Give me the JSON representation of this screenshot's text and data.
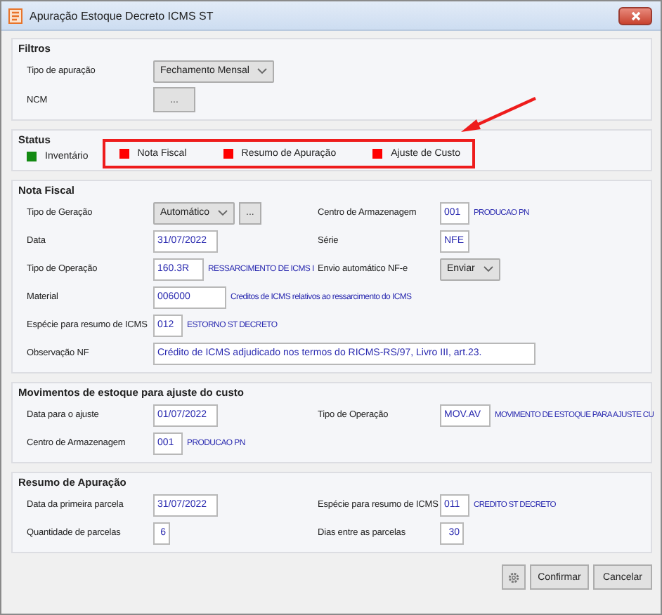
{
  "window": {
    "title": "Apuração Estoque Decreto ICMS ST"
  },
  "sections": [
    {
      "title": "Filtros",
      "kind": "form",
      "rows": [
        {
          "left": {
            "label": "Tipo de apuração",
            "control": {
              "kind": "select",
              "value": "Fechamento Mensal"
            }
          }
        },
        {
          "left": {
            "label": "NCM",
            "control": {
              "kind": "button",
              "value": "..."
            }
          }
        }
      ]
    },
    {
      "title": "Status",
      "kind": "status",
      "items": [
        {
          "label": "Inventário",
          "color": "#138a13",
          "highlighted": false
        },
        {
          "label": "Nota Fiscal",
          "color": "#ff0000",
          "highlighted": true
        },
        {
          "label": "Resumo de Apuração",
          "color": "#ff0000",
          "highlighted": true
        },
        {
          "label": "Ajuste de Custo",
          "color": "#ff0000",
          "highlighted": true
        }
      ]
    },
    {
      "title": "Nota Fiscal",
      "kind": "form",
      "rows": [
        {
          "left": {
            "label": "Tipo de Geração",
            "control": {
              "kind": "select-more",
              "value": "Automático",
              "button": "..."
            }
          },
          "right": {
            "label": "Centro de Armazenagem",
            "control": {
              "kind": "code",
              "value": "001",
              "description": "PRODUCAO PN"
            }
          }
        },
        {
          "left": {
            "label": "Data",
            "control": {
              "kind": "date",
              "value": "31/07/2022"
            }
          },
          "right": {
            "label": "Série",
            "control": {
              "kind": "code",
              "value": "NFE"
            }
          }
        },
        {
          "left": {
            "label": "Tipo de Operação",
            "control": {
              "kind": "code",
              "value": "160.3R",
              "description": "RESSARCIMENTO DE ICMS I"
            }
          },
          "right": {
            "label": "Envio automático NF-e",
            "control": {
              "kind": "select",
              "value": "Enviar"
            }
          }
        },
        {
          "left": {
            "label": "Material",
            "control": {
              "kind": "item",
              "value": "006000",
              "description": "Creditos de ICMS relativos ao ressarcimento do ICMS"
            }
          }
        },
        {
          "left": {
            "label": "Espécie para resumo de ICMS",
            "control": {
              "kind": "code",
              "value": "012",
              "description": "ESTORNO ST DECRETO"
            }
          }
        },
        {
          "left": {
            "label": "Observação NF",
            "control": {
              "kind": "memo",
              "value": "Crédito de ICMS adjudicado nos termos do RICMS-RS/97, Livro III, art.23."
            }
          }
        }
      ]
    },
    {
      "title": "Movimentos de estoque para ajuste do custo",
      "kind": "form",
      "rows": [
        {
          "left": {
            "label": "Data para o ajuste",
            "control": {
              "kind": "date",
              "value": "01/07/2022"
            }
          },
          "right": {
            "label": "Tipo de Operação",
            "control": {
              "kind": "code",
              "value": "MOV.AV",
              "description": "MOVIMENTO DE ESTOQUE PARA AJUSTE CU"
            }
          }
        },
        {
          "left": {
            "label": "Centro de Armazenagem",
            "control": {
              "kind": "code",
              "value": "001",
              "description": "PRODUCAO PN"
            }
          }
        }
      ]
    },
    {
      "title": "Resumo de Apuração",
      "kind": "form",
      "rows": [
        {
          "left": {
            "label": "Data da primeira parcela",
            "control": {
              "kind": "date",
              "value": "31/07/2022"
            }
          },
          "right": {
            "label": "Espécie para resumo de ICMS",
            "control": {
              "kind": "code",
              "value": "011",
              "description": "CREDITO ST DECRETO"
            }
          }
        },
        {
          "left": {
            "label": "Quantidade de parcelas",
            "control": {
              "kind": "number",
              "value": "6"
            }
          },
          "right": {
            "label": "Dias entre as parcelas",
            "control": {
              "kind": "number",
              "value": "30"
            }
          }
        }
      ]
    }
  ],
  "buttons": [
    "Confirmar",
    "Cancelar"
  ]
}
